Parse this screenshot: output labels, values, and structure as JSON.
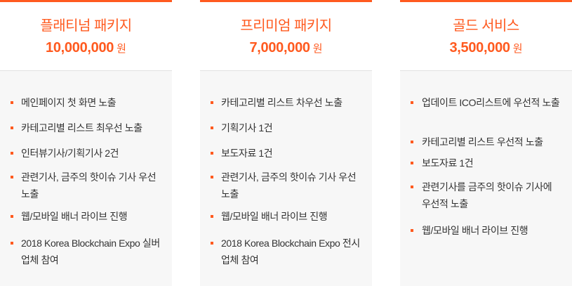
{
  "accent_color": "#ff5a1f",
  "packages": [
    {
      "name": "플래티넘 패키지",
      "price": "10,000,000",
      "unit": "원",
      "features": [
        "메인페이지 첫 화면 노출",
        "카테고리별 리스트 최우선 노출",
        "인터뷰기사/기획기사 2건",
        "관련기사, 금주의 핫이슈 기사 우선 노출",
        "웹/모바일 배너 라이브 진행",
        "2018 Korea Blockchain Expo 실버업체 참여"
      ]
    },
    {
      "name": "프리미엄 패키지",
      "price": "7,000,000",
      "unit": "원",
      "features": [
        "카테고리별 리스트 차우선 노출",
        "기획기사 1건",
        "보도자료 1건",
        "관련기사, 금주의 핫이슈 기사 우선 노출",
        "웹/모바일 배너 라이브 진행",
        "2018 Korea Blockchain Expo 전시업체 참여"
      ]
    },
    {
      "name": "골드 서비스",
      "price": "3,500,000",
      "unit": "원",
      "features": [
        "업데이트 ICO리스트에 우선적 노출",
        "카테고리별 리스트 우선적 노출",
        "보도자료 1건",
        "관련기사를 금주의 핫이슈 기사에 우선적 노출",
        "웹/모바일 배너 라이브 진행"
      ]
    }
  ]
}
